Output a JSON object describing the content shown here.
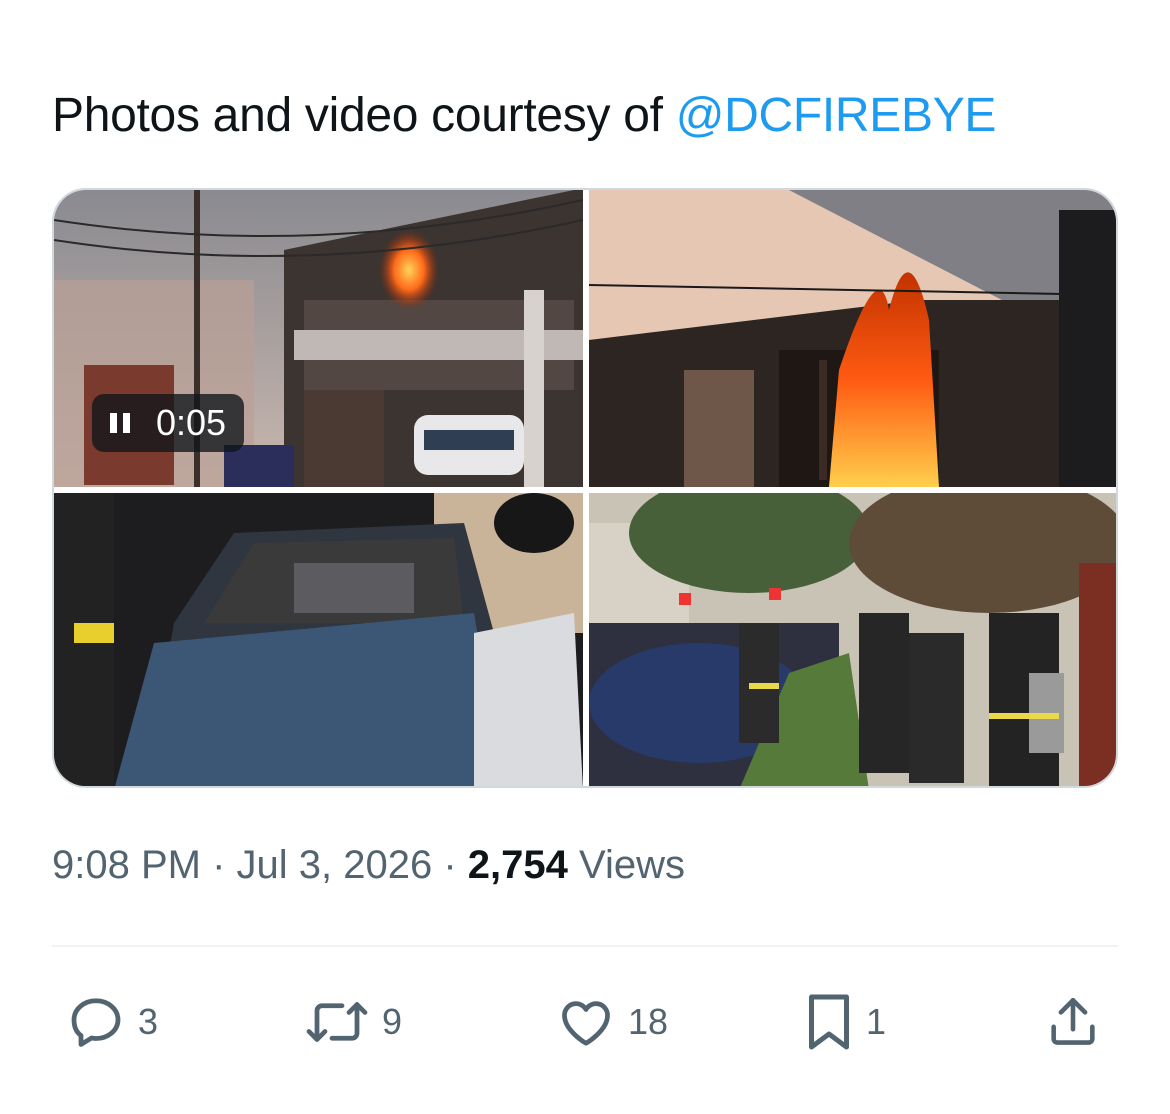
{
  "tweet": {
    "text_prefix": "Photos and video courtesy of ",
    "mention": "@DCFIREBYE"
  },
  "media": {
    "video_duration": "0:05",
    "video_state_icon": "pause-icon"
  },
  "meta": {
    "time": "9:08 PM",
    "separator1": " · ",
    "date": "Jul 3, 2026",
    "separator2": " · ",
    "views_count": "2,754",
    "views_label": " Views"
  },
  "actions": {
    "reply_count": "3",
    "retweet_count": "9",
    "like_count": "18",
    "bookmark_count": "1"
  },
  "colors": {
    "link": "#1d9bf0",
    "secondary_text": "#536471",
    "primary_text": "#0f1419",
    "border": "#cfd9de"
  }
}
